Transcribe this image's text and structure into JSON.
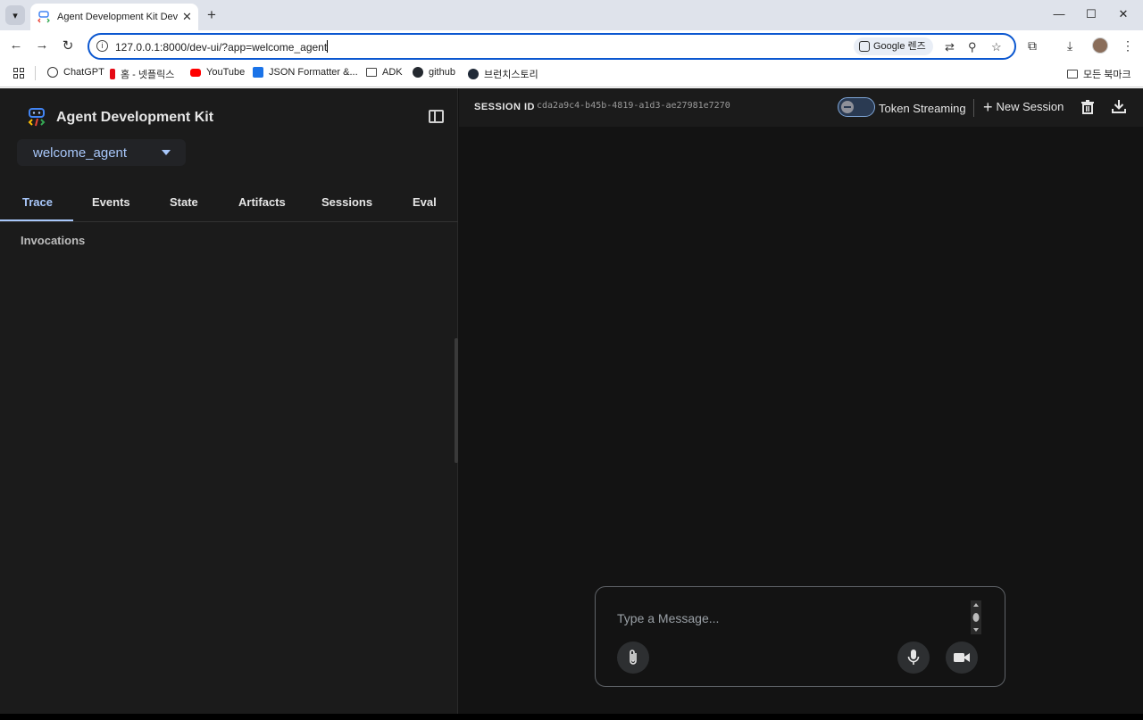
{
  "browser": {
    "tab_title": "Agent Development Kit Dev UI",
    "url": "127.0.0.1:8000/dev-ui/?app=welcome_agent",
    "lens_label": "Google 렌즈",
    "bookmarks": [
      "ChatGPT",
      "홈 - 넷플릭스",
      "YouTube",
      "JSON Formatter &...",
      "ADK",
      "github",
      "브런치스토리"
    ],
    "all_bookmarks": "모든 북마크"
  },
  "sidebar": {
    "brand": "Agent Development Kit",
    "selected_agent": "welcome_agent",
    "tabs": [
      "Trace",
      "Events",
      "State",
      "Artifacts",
      "Sessions",
      "Eval"
    ],
    "active_tab": "Trace",
    "section_title": "Invocations"
  },
  "header": {
    "session_label": "SESSION ID",
    "session_id": "cda2a9c4-b45b-4819-a1d3-ae27981e7270",
    "token_streaming_label": "Token Streaming",
    "token_streaming_enabled": false,
    "new_session_label": "New Session"
  },
  "composer": {
    "placeholder": "Type a Message..."
  },
  "colors": {
    "accent": "#a8c7fa",
    "sidebar_bg": "#1b1b1b",
    "main_bg": "#131313"
  }
}
